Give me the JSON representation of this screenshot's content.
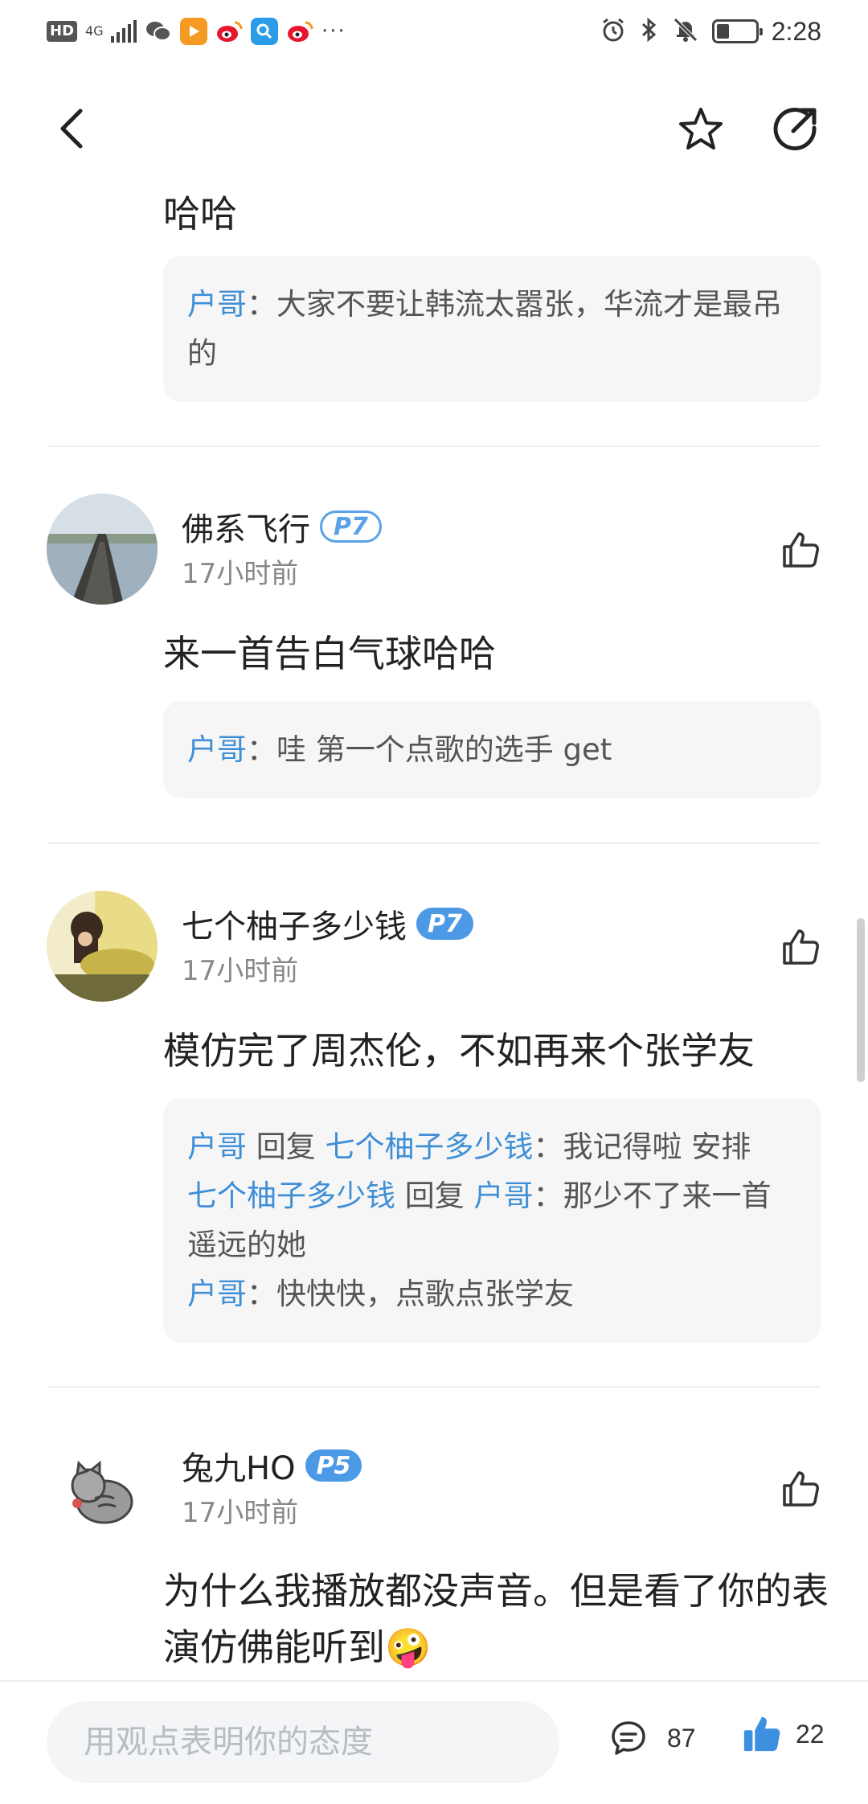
{
  "status_bar": {
    "hd_label": "HD",
    "network": "4G",
    "time": "2:28",
    "more": "···",
    "battery_level": 0.3
  },
  "colors": {
    "accent_blue": "#3f8fd6",
    "badge_blue": "#4c9ae6",
    "reply_bg": "#f6f6f7"
  },
  "fragment": {
    "text": "哈哈",
    "replies": [
      {
        "name": "户哥",
        "sep": "：",
        "text": "大家不要让韩流太嚣张，华流才是最吊的"
      }
    ]
  },
  "comments": [
    {
      "username": "佛系飞行",
      "badge": "P7",
      "time": "17小时前",
      "text": "来一首告白气球哈哈",
      "replies": [
        {
          "name": "户哥",
          "sep": "：",
          "text": "哇 第一个点歌的选手 get"
        }
      ]
    },
    {
      "username": "七个柚子多少钱",
      "badge": "P7",
      "time": "17小时前",
      "text": "模仿完了周杰伦，不如再来个张学友",
      "replies": [
        {
          "name": "户哥",
          "reply_word": " 回复 ",
          "target": "七个柚子多少钱",
          "sep": "：",
          "text": "我记得啦 安排"
        },
        {
          "name": "七个柚子多少钱",
          "reply_word": " 回复 ",
          "target": "户哥",
          "sep": "：",
          "text": "那少不了来一首遥远的她"
        },
        {
          "name": "户哥",
          "sep": "：",
          "text": "快快快，点歌点张学友"
        }
      ]
    },
    {
      "username": "兔九HO",
      "badge": "P5",
      "time": "17小时前",
      "text": "为什么我播放都没声音。但是看了你的表演仿佛能听到🤪"
    }
  ],
  "bottom_bar": {
    "input_placeholder": "用观点表明你的态度",
    "comment_count": "87",
    "like_count": "22"
  },
  "icons": {
    "back": "chevron-left-icon",
    "favorite": "star-icon",
    "share": "share-arrow-icon",
    "like": "thumbs-up-icon",
    "comment": "comment-bubble-icon"
  }
}
